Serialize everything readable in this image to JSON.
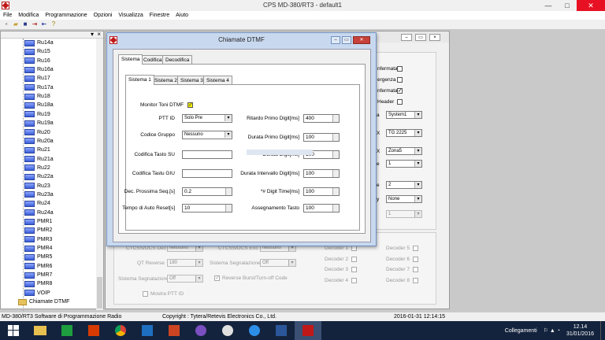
{
  "app": {
    "title": "CPS MD-380/RT3 - default1",
    "menu": [
      "File",
      "Modifica",
      "Programmazione",
      "Opzioni",
      "Visualizza",
      "Finestre",
      "Aiuto"
    ]
  },
  "tree": {
    "items": [
      "Ru14a",
      "Ru15",
      "Ru16",
      "Ru16a",
      "Ru17",
      "Ru17a",
      "Ru18",
      "Ru18a",
      "Ru19",
      "Ru19a",
      "Ru20",
      "Ru20a",
      "Ru21",
      "Ru21a",
      "Ru22",
      "Ru22a",
      "Ru23",
      "Ru23a",
      "Ru24",
      "Ru24a",
      "PMR1",
      "PMR2",
      "PMR3",
      "PMR4",
      "PMR5",
      "PMR6",
      "PMR7",
      "PMR8",
      "VOIP"
    ],
    "folder_label": "Chiamate DTMF"
  },
  "background_window": {
    "checks": [
      {
        "label": "nfermata",
        "checked": false
      },
      {
        "label": "ergenza",
        "checked": false
      },
      {
        "label": "nfermata",
        "checked": true
      },
      {
        "label": "Header",
        "checked": false
      }
    ],
    "combos": [
      {
        "prefix": "a",
        "value": "System1"
      },
      {
        "prefix": "X",
        "value": "TG 2225"
      },
      {
        "prefix": "X",
        "value": "Zona5"
      },
      {
        "prefix": "e",
        "value": "1"
      },
      {
        "prefix": "e",
        "value": "2"
      },
      {
        "prefix": "y",
        "value": "None"
      },
      {
        "prefix": "",
        "value": "1"
      }
    ],
    "lower": {
      "ctcss_dec_label": "CTCSS/DCS Dec",
      "ctcss_dec_value": "Nessuno",
      "ctcss_enc_label": "CTCSS/DCS Enc",
      "ctcss_enc_value": "Nessuno",
      "qt_reverse_label": "QT Reverse",
      "qt_reverse_value": "180",
      "sistema_segn_label": "Sistema Segnalazione",
      "sistema_segn_value": "Off",
      "sistema_segn2_label": "Sistema Segnalazione",
      "sistema_segn2_value": "Off",
      "reverse_burst_label": "Reverse Burst/Turn-off Code",
      "mostra_ptt_label": "Mostra PTT ID",
      "decoders": [
        "Decoder 1",
        "Decoder 2",
        "Decoder 3",
        "Decoder 4",
        "Decoder 5",
        "Decoder 6",
        "Decoder 7",
        "Decoder 8"
      ]
    }
  },
  "dialog": {
    "title": "Chiamate DTMF",
    "outer_tabs": [
      "Sistema",
      "Codifica",
      "Decodifica"
    ],
    "inner_tabs": [
      "Sistema 1",
      "Sistema 2",
      "Sistema 3",
      "Sistema 4"
    ],
    "monitor_label": "Monitor Toni DTMF",
    "left_fields": [
      {
        "label": "PTT ID",
        "value": "Solo Pre",
        "type": "combo"
      },
      {
        "label": "Codice Gruppo",
        "value": "Nessuno",
        "type": "combo"
      },
      {
        "label": "Codifica Tasto SU",
        "value": "",
        "type": "text"
      },
      {
        "label": "Codifica Tastu GIU",
        "value": "",
        "type": "text"
      },
      {
        "label": "Dec. Prossima Seq.[s]",
        "value": "0.2",
        "type": "spin"
      },
      {
        "label": "Tempo di Auto Reset[s]",
        "value": "10",
        "type": "spin"
      }
    ],
    "right_fields": [
      {
        "label": "Ritardo Primo Digit[ms]",
        "value": "400"
      },
      {
        "label": "Durata Primo Digit[ms]",
        "value": "100"
      },
      {
        "label": "Durata Digit[ms]",
        "value": "100"
      },
      {
        "label": "Durata Intervallo Digit[ms]",
        "value": "100"
      },
      {
        "label": "*# Digit Time[ms]",
        "value": "100"
      },
      {
        "label": "Assegnamento Tasto",
        "value": "100"
      }
    ]
  },
  "status": {
    "left": "MD-380/RT3 Software di Programmazione Radio",
    "center": "Copyright : Tytera/Retevis Electronics Co., Ltd.",
    "datetime": "2016-01-31 12:14:15"
  },
  "taskbar": {
    "network_label": "Collegamenti",
    "time": "12.14",
    "date": "31/01/2016"
  }
}
